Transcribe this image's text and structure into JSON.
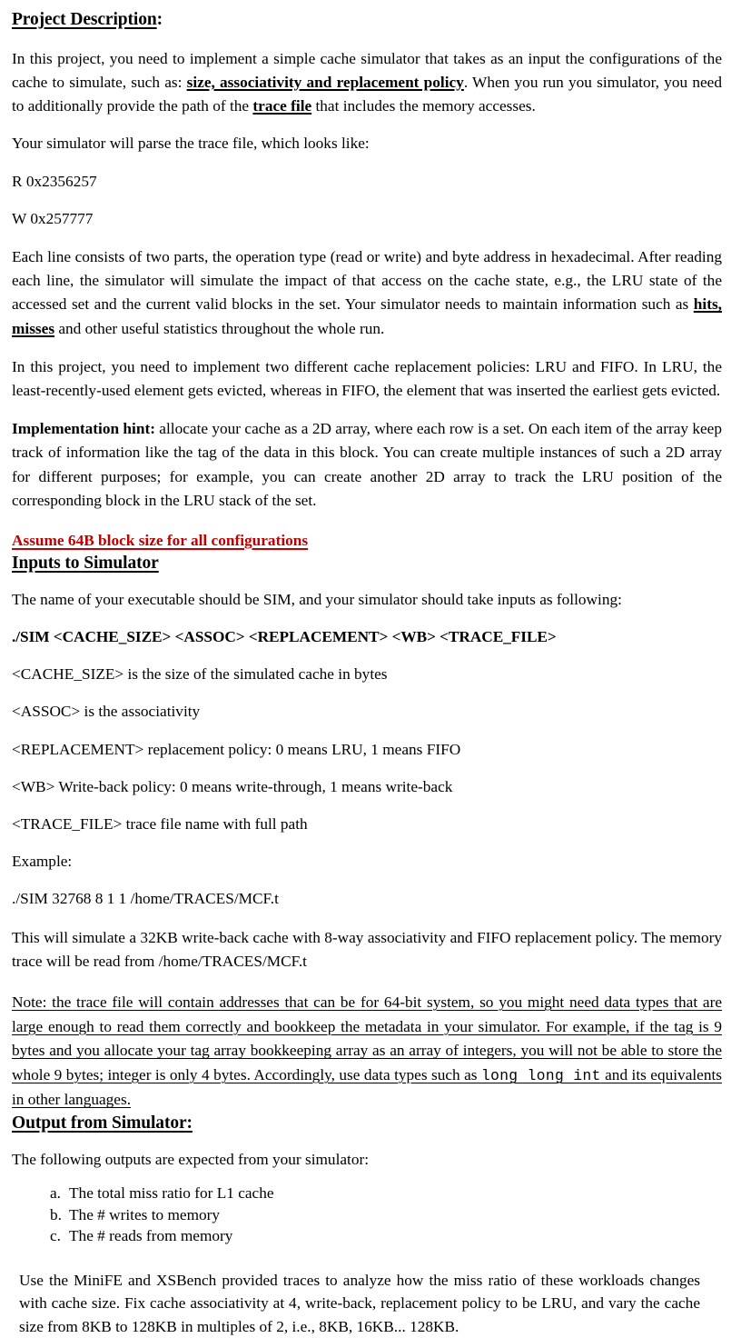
{
  "document": {
    "sections": {
      "project_description": {
        "heading_text": "Project Description",
        "heading_suffix": ":",
        "paragraph1": {
          "part1": "In this project, you need to implement a simple cache simulator that takes as an input the configurations of the cache to simulate, such as: ",
          "emphasis1": "size, associativity and replacement policy",
          "part2": ". When you run you simulator, you need to additionally provide the path of the ",
          "emphasis2": "trace file",
          "part3": " that includes the memory accesses."
        },
        "paragraph2": "Your simulator will parse the trace file, which looks like:",
        "trace_line_read": "R 0x2356257",
        "trace_line_write": "W 0x257777",
        "paragraph3": {
          "part1": "Each line consists of two parts, the operation type (read or write) and byte address in hexadecimal. After reading each line, the simulator will simulate the impact of that access on the cache state, e.g., the LRU state of the accessed set and the current valid blocks in the set. Your simulator needs to maintain information such as ",
          "emphasis1": "hits,",
          "part2": " ",
          "emphasis2": "misses",
          "part3": " and other useful statistics throughout the whole run."
        },
        "paragraph4": "In this project, you need to implement two different cache replacement policies: LRU and FIFO. In LRU, the least-recently-used element gets evicted, whereas in FIFO, the element that was inserted the earliest gets evicted.",
        "paragraph5": {
          "label": "Implementation hint:",
          "text": " allocate your cache as a 2D array, where each row is a set. On each item of the array keep track of information like the tag of the data in this block. You can create multiple instances of such a 2D array for different purposes; for example, you can create another 2D array to track the LRU position of the corresponding block in the LRU stack of the set."
        },
        "red_notice": "Assume 64B block size for all configurations",
        "red_color": "#C00000"
      },
      "inputs_to_simulator": {
        "heading_text": "Inputs to Simulator",
        "intro": "The name of your executable should be SIM, and your simulator should take inputs as following:",
        "command_syntax": "./SIM <CACHE_SIZE> <ASSOC> <REPLACEMENT> <WB>  <TRACE_FILE>",
        "arguments": [
          "<CACHE_SIZE> is the size of the simulated cache in bytes",
          "<ASSOC> is the associativity",
          "<REPLACEMENT> replacement policy: 0 means LRU, 1 means FIFO",
          "<WB> Write-back policy: 0 means write-through, 1 means write-back",
          "<TRACE_FILE> trace file name with full path"
        ],
        "example_label": "Example:",
        "example_command": "./SIM 32768 8 1 1 /home/TRACES/MCF.t",
        "example_explanation": "This will simulate a 32KB write-back cache with 8-way associativity and FIFO replacement policy. The memory trace will be read from /home/TRACES/MCF.t",
        "note": {
          "part1": "Note: the trace file will contain addresses that can be for 64-bit system, so you might need data types that are large enough to read them correctly and bookkeep the metadata in your simulator. For example, if the tag is 9 bytes and you allocate your tag array bookkeeping array as an array of integers, you will not be able to store the whole 9 bytes; integer is only 4 bytes. Accordingly, use data types such as ",
          "code": "long long int",
          "part2": " and its equivalents in other languages."
        }
      },
      "output_from_simulator": {
        "heading_text": "Output from Simulator:",
        "intro": "The following outputs are expected from your simulator:",
        "outputs": [
          "The total miss ratio for L1 cache",
          "The # writes to memory",
          "The # reads from memory"
        ],
        "final_paragraph": "Use the MiniFE and XSBench provided traces to analyze how the miss ratio of these workloads changes with cache size. Fix cache associativity at 4, write-back, replacement policy to be LRU, and vary the cache size from 8KB to 128KB in multiples of 2, i.e., 8KB, 16KB... 128KB."
      }
    }
  }
}
